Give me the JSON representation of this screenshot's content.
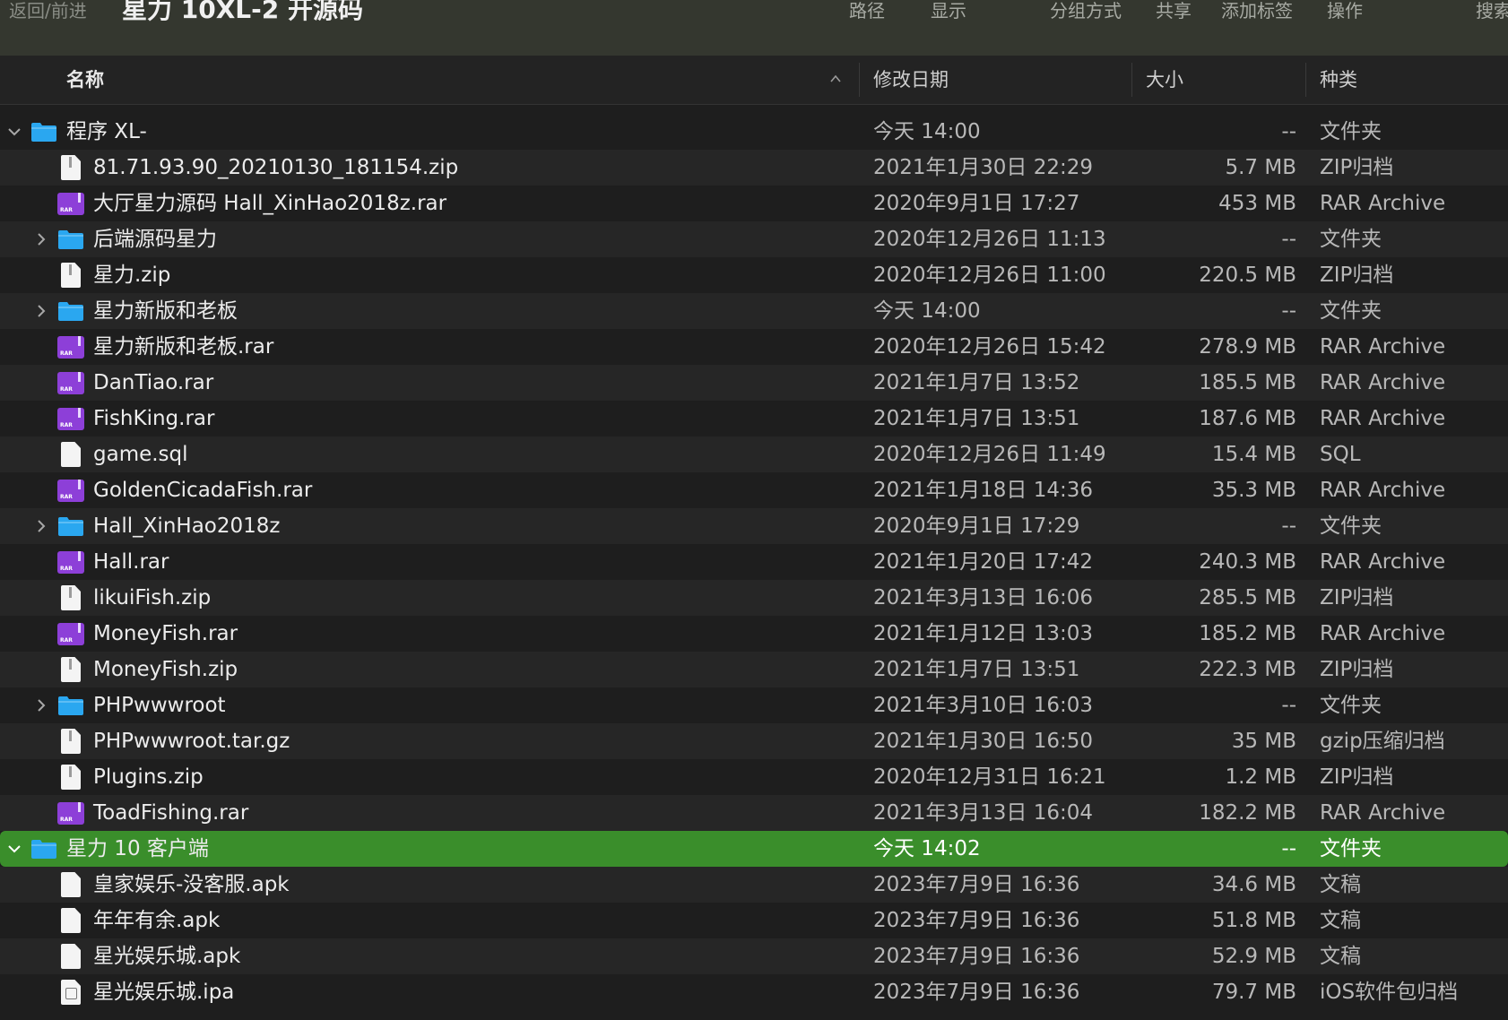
{
  "toolbar": {
    "nav": "返回/前进",
    "title": "星力 10XL-2 开源码",
    "path": "路径",
    "view": "显示",
    "group": "分组方式",
    "share": "共享",
    "tags": "添加标签",
    "action": "操作",
    "search": "搜索"
  },
  "columns": {
    "name": "名称",
    "date": "修改日期",
    "size": "大小",
    "kind": "种类"
  },
  "rows": [
    {
      "name": "程序 XL-",
      "date": "今天 14:00",
      "size": "--",
      "kind": "文件夹",
      "icon": "folder-icon",
      "depth": 0,
      "disclosure": "expanded"
    },
    {
      "name": "81.71.93.90_20210130_181154.zip",
      "date": "2021年1月30日 22:29",
      "size": "5.7 MB",
      "kind": "ZIP归档",
      "icon": "zip-file-icon",
      "depth": 1
    },
    {
      "name": "大厅星力源码 Hall_XinHao2018z.rar",
      "date": "2020年9月1日 17:27",
      "size": "453 MB",
      "kind": "RAR Archive",
      "icon": "rar-file-icon",
      "depth": 1
    },
    {
      "name": "后端源码星力",
      "date": "2020年12月26日 11:13",
      "size": "--",
      "kind": "文件夹",
      "icon": "folder-icon",
      "depth": 1,
      "disclosure": "collapsed"
    },
    {
      "name": "星力.zip",
      "date": "2020年12月26日 11:00",
      "size": "220.5 MB",
      "kind": "ZIP归档",
      "icon": "zip-file-icon",
      "depth": 1
    },
    {
      "name": "星力新版和老板",
      "date": "今天 14:00",
      "size": "--",
      "kind": "文件夹",
      "icon": "folder-icon",
      "depth": 1,
      "disclosure": "collapsed"
    },
    {
      "name": "星力新版和老板.rar",
      "date": "2020年12月26日 15:42",
      "size": "278.9 MB",
      "kind": "RAR Archive",
      "icon": "rar-file-icon",
      "depth": 1
    },
    {
      "name": "DanTiao.rar",
      "date": "2021年1月7日 13:52",
      "size": "185.5 MB",
      "kind": "RAR Archive",
      "icon": "rar-file-icon",
      "depth": 1
    },
    {
      "name": "FishKing.rar",
      "date": "2021年1月7日 13:51",
      "size": "187.6 MB",
      "kind": "RAR Archive",
      "icon": "rar-file-icon",
      "depth": 1
    },
    {
      "name": "game.sql",
      "date": "2020年12月26日 11:49",
      "size": "15.4 MB",
      "kind": "SQL",
      "icon": "document-icon",
      "depth": 1
    },
    {
      "name": "GoldenCicadaFish.rar",
      "date": "2021年1月18日 14:36",
      "size": "35.3 MB",
      "kind": "RAR Archive",
      "icon": "rar-file-icon",
      "depth": 1
    },
    {
      "name": "Hall_XinHao2018z",
      "date": "2020年9月1日 17:29",
      "size": "--",
      "kind": "文件夹",
      "icon": "folder-icon",
      "depth": 1,
      "disclosure": "collapsed"
    },
    {
      "name": "Hall.rar",
      "date": "2021年1月20日 17:42",
      "size": "240.3 MB",
      "kind": "RAR Archive",
      "icon": "rar-file-icon",
      "depth": 1
    },
    {
      "name": "likuiFish.zip",
      "date": "2021年3月13日 16:06",
      "size": "285.5 MB",
      "kind": "ZIP归档",
      "icon": "zip-file-icon",
      "depth": 1
    },
    {
      "name": "MoneyFish.rar",
      "date": "2021年1月12日 13:03",
      "size": "185.2 MB",
      "kind": "RAR Archive",
      "icon": "rar-file-icon",
      "depth": 1
    },
    {
      "name": "MoneyFish.zip",
      "date": "2021年1月7日 13:51",
      "size": "222.3 MB",
      "kind": "ZIP归档",
      "icon": "zip-file-icon",
      "depth": 1
    },
    {
      "name": "PHPwwwroot",
      "date": "2021年3月10日 16:03",
      "size": "--",
      "kind": "文件夹",
      "icon": "folder-icon",
      "depth": 1,
      "disclosure": "collapsed"
    },
    {
      "name": "PHPwwwroot.tar.gz",
      "date": "2021年1月30日 16:50",
      "size": "35 MB",
      "kind": "gzip压缩归档",
      "icon": "zip-file-icon",
      "depth": 1
    },
    {
      "name": "Plugins.zip",
      "date": "2020年12月31日 16:21",
      "size": "1.2 MB",
      "kind": "ZIP归档",
      "icon": "zip-file-icon",
      "depth": 1
    },
    {
      "name": "ToadFishing.rar",
      "date": "2021年3月13日 16:04",
      "size": "182.2 MB",
      "kind": "RAR Archive",
      "icon": "rar-file-icon",
      "depth": 1
    },
    {
      "name": "星力 10 客户端",
      "date": "今天 14:02",
      "size": "--",
      "kind": "文件夹",
      "icon": "folder-icon",
      "depth": 0,
      "disclosure": "expanded",
      "selected": true
    },
    {
      "name": "皇家娱乐-没客服.apk",
      "date": "2023年7月9日 16:36",
      "size": "34.6 MB",
      "kind": "文稿",
      "icon": "document-icon",
      "depth": 1
    },
    {
      "name": "年年有余.apk",
      "date": "2023年7月9日 16:36",
      "size": "51.8 MB",
      "kind": "文稿",
      "icon": "document-icon",
      "depth": 1
    },
    {
      "name": "星光娱乐城.apk",
      "date": "2023年7月9日 16:36",
      "size": "52.9 MB",
      "kind": "文稿",
      "icon": "document-icon",
      "depth": 1
    },
    {
      "name": "星光娱乐城.ipa",
      "date": "2023年7月9日 16:36",
      "size": "79.7 MB",
      "kind": "iOS软件包归档",
      "icon": "ipa-file-icon",
      "depth": 1
    }
  ],
  "colors": {
    "selection": "#3a8e2b",
    "folder": "#2aa7f0",
    "rar": "#8d3fd8",
    "background": "#1e1e1e"
  }
}
